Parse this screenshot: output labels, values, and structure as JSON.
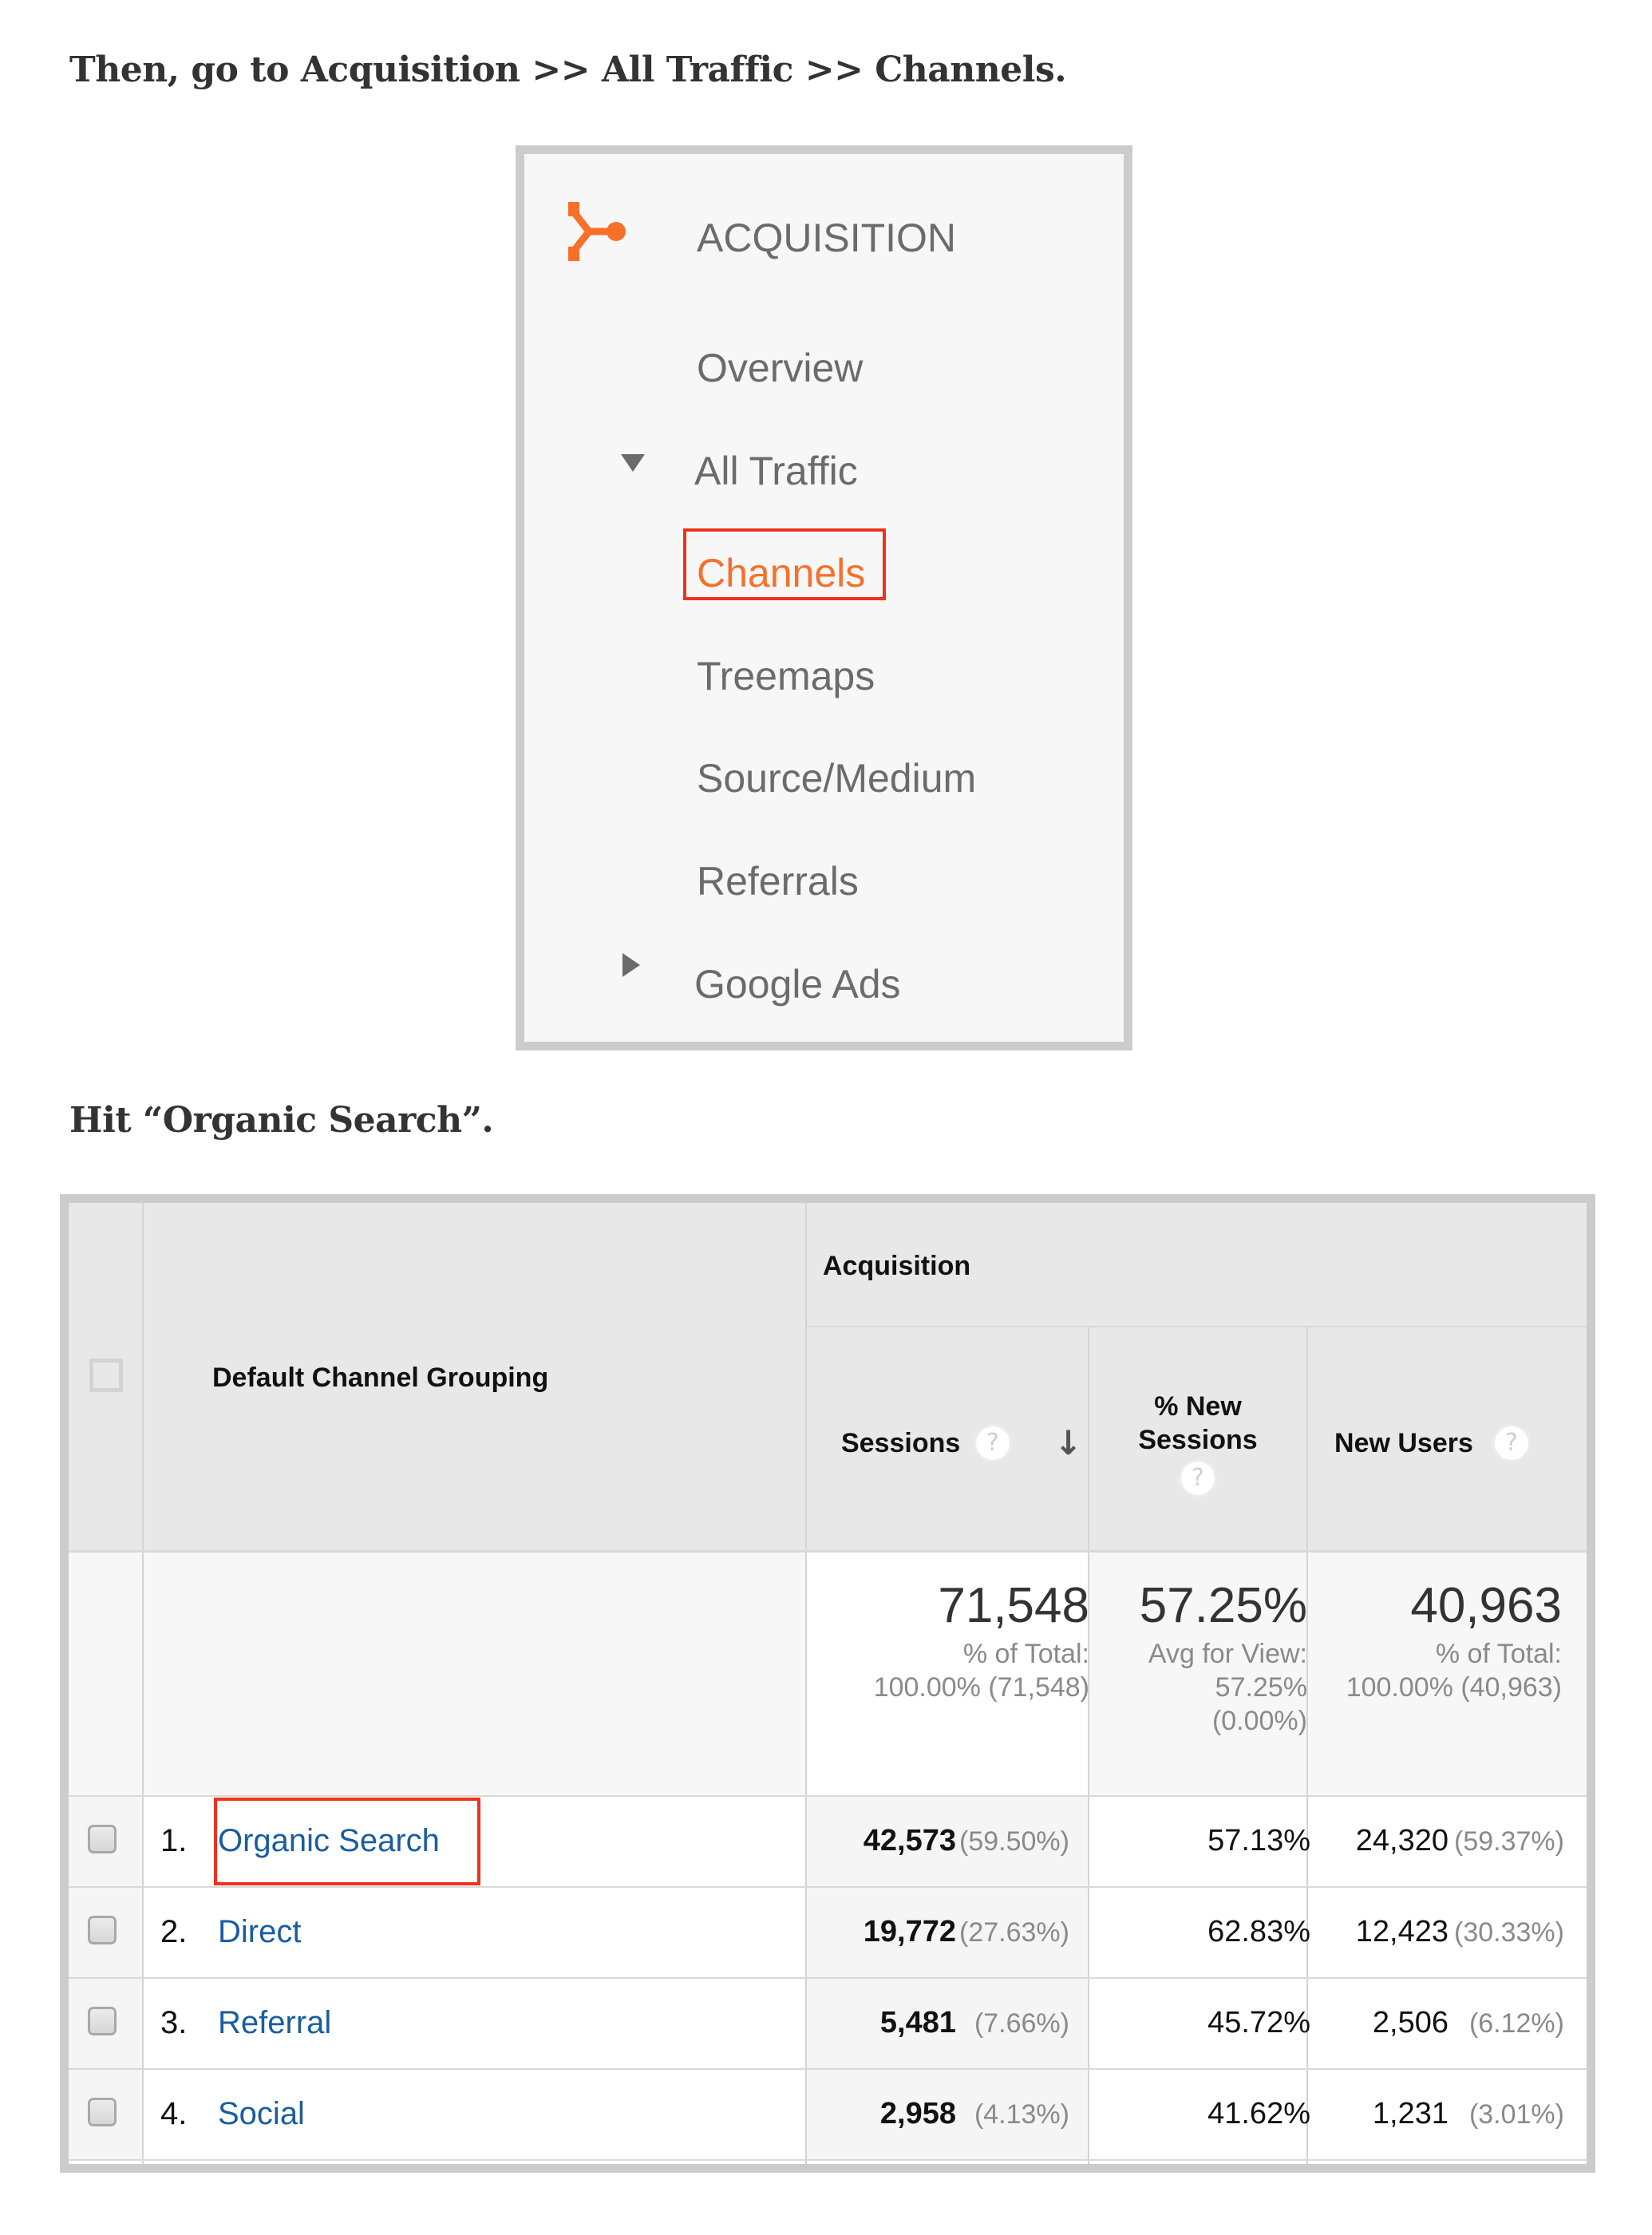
{
  "instructions": {
    "step1": "Then, go to Acquisition >> All Traffic >> Channels.",
    "step2": "Hit “Organic Search”."
  },
  "nav": {
    "section_title": "ACQUISITION",
    "section_icon": "acquisition-icon",
    "accent_color": "#f7702a",
    "highlight_color": "#f0311b",
    "items": [
      {
        "label": "Overview"
      },
      {
        "label": "All Traffic",
        "expander": "triangle-down-icon",
        "expanded": true
      },
      {
        "label": "Channels",
        "active": true,
        "highlighted": true
      },
      {
        "label": "Treemaps"
      },
      {
        "label": "Source/Medium"
      },
      {
        "label": "Referrals"
      },
      {
        "label": "Google Ads",
        "expander": "triangle-right-icon",
        "expanded": false
      }
    ]
  },
  "table": {
    "dimension_header": "Default Channel Grouping",
    "group_header": "Acquisition",
    "columns": [
      {
        "label": "Sessions",
        "help": "?",
        "sorted": "descending"
      },
      {
        "label": "% New Sessions",
        "label_line1": "% New",
        "label_line2": "Sessions",
        "help": "?"
      },
      {
        "label": "New Users",
        "help": "?"
      }
    ],
    "totals": {
      "sessions": {
        "value": "71,548",
        "sub1": "% of Total:",
        "sub2": "100.00% (71,548)"
      },
      "new_sessions": {
        "value": "57.25%",
        "sub1": "Avg for View:",
        "sub2": "57.25%",
        "sub3": "(0.00%)"
      },
      "new_users": {
        "value": "40,963",
        "sub1": "% of Total:",
        "sub2": "100.00% (40,963)"
      }
    },
    "link_color": "#1a5d9e",
    "rows": [
      {
        "rank": "1.",
        "channel": "Organic Search",
        "highlighted": true,
        "sessions": "42,573",
        "sessions_pct": "(59.50%)",
        "new_sessions": "57.13%",
        "new_users": "24,320",
        "new_users_pct": "(59.37%)"
      },
      {
        "rank": "2.",
        "channel": "Direct",
        "sessions": "19,772",
        "sessions_pct": "(27.63%)",
        "new_sessions": "62.83%",
        "new_users": "12,423",
        "new_users_pct": "(30.33%)"
      },
      {
        "rank": "3.",
        "channel": "Referral",
        "sessions": "5,481",
        "sessions_pct": "(7.66%)",
        "new_sessions": "45.72%",
        "new_users": "2,506",
        "new_users_pct": "(6.12%)"
      },
      {
        "rank": "4.",
        "channel": "Social",
        "sessions": "2,958",
        "sessions_pct": "(4.13%)",
        "new_sessions": "41.62%",
        "new_users": "1,231",
        "new_users_pct": "(3.01%)"
      }
    ]
  }
}
